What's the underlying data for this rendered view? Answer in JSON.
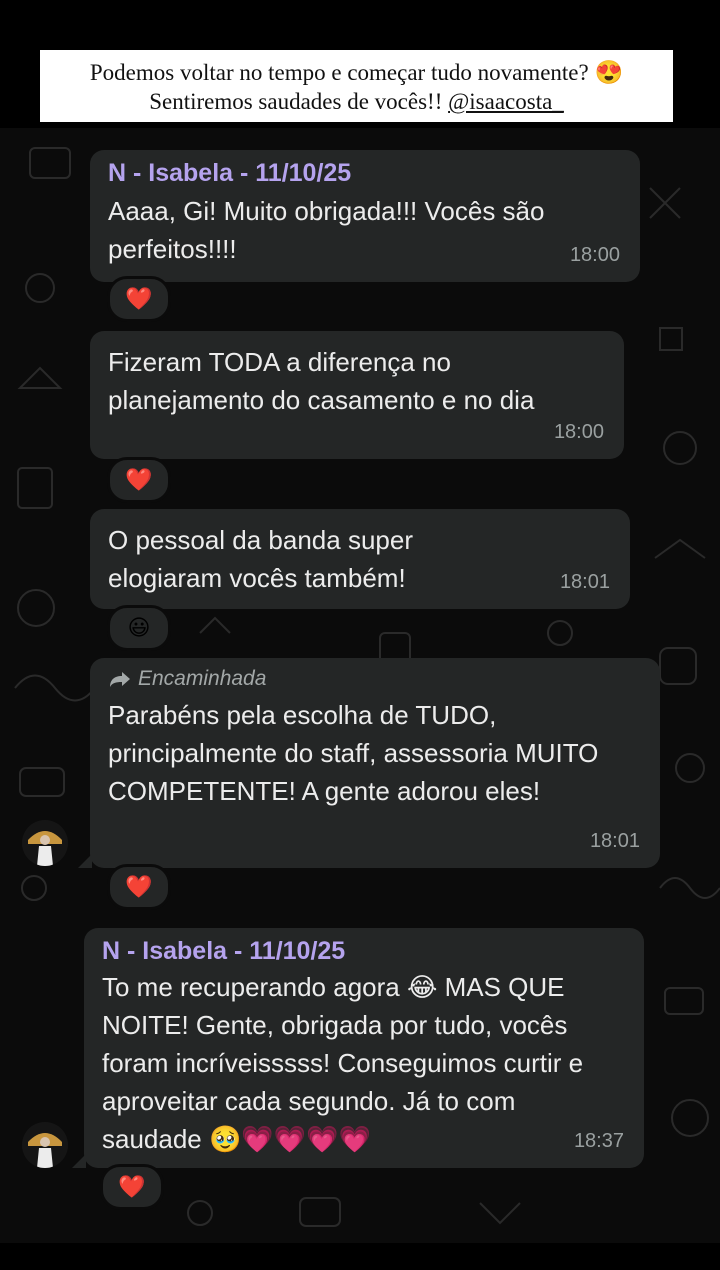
{
  "caption": {
    "line1": "Podemos voltar no tempo e começar tudo novamente? 😍",
    "line2_text": "Sentiremos saudades de vocês!!",
    "line2_handle": "@isaacosta_"
  },
  "messages": [
    {
      "sender": "N - Isabela - 11/10/25",
      "text": "Aaaa, Gi! Muito obrigada!!! Vocês são perfeitos!!!!",
      "time": "18:00",
      "reaction": "❤️"
    },
    {
      "text": "Fizeram TODA a diferença no planejamento do casamento e no dia",
      "time": "18:00",
      "reaction": "❤️"
    },
    {
      "text": "O pessoal da banda super elogiaram vocês também!",
      "time": "18:01",
      "reaction": "😃"
    },
    {
      "forwarded_label": "Encaminhada",
      "text": "Parabéns pela escolha de TUDO, principalmente do staff, assessoria MUITO COMPETENTE! A gente adorou eles!",
      "time": "18:01",
      "reaction": "❤️"
    },
    {
      "sender": "N - Isabela - 11/10/25",
      "text": "To me recuperando agora 😂 MAS QUE NOITE! Gente, obrigada por tudo, vocês foram incríveisssss! Conseguimos curtir e aproveitar cada segundo. Já to com saudade 🥹💗💗💗💗",
      "time": "18:37",
      "reaction": "❤️"
    }
  ],
  "colors": {
    "bubble": "#242626",
    "sender": "#b5a3ee",
    "background": "#0b0b0b"
  }
}
